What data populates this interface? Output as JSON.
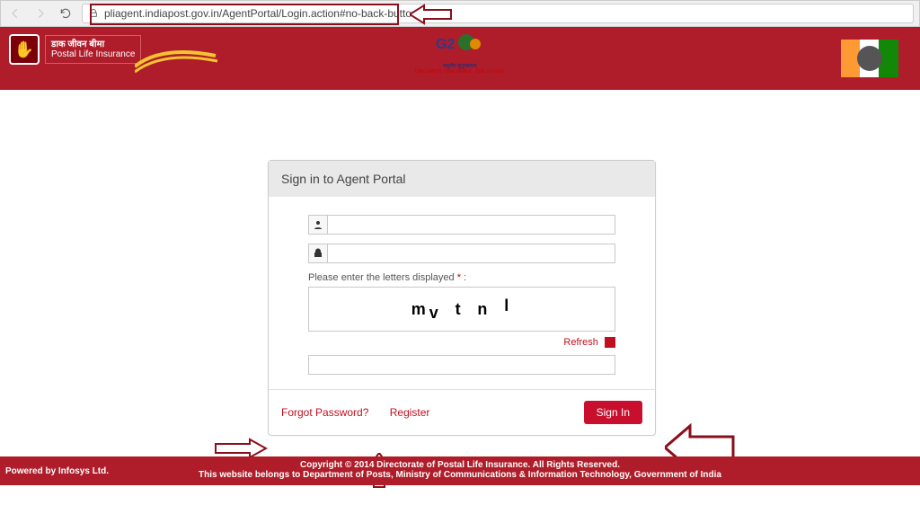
{
  "browser": {
    "url": "pliagent.indiapost.gov.in/AgentPortal/Login.action#no-back-button"
  },
  "brand": {
    "name_hi": "डाक जीवन बीमा",
    "name_en": "Postal Life Insurance"
  },
  "login": {
    "title": "Sign in to Agent Portal",
    "captcha_label": "Please enter the letters displayed",
    "captcha_chars": [
      "m",
      "v",
      "t",
      "n",
      "l"
    ],
    "refresh": "Refresh",
    "forgot": "Forgot Password?",
    "register": "Register",
    "signin": "Sign In"
  },
  "footer": {
    "powered": "Powered by Infosys Ltd.",
    "line1": "Copyright © 2014 Directorate of Postal Life Insurance. All Rights Reserved.",
    "line2": "This website belongs to Department of Posts, Ministry of Communications & Information Technology, Government of India"
  }
}
